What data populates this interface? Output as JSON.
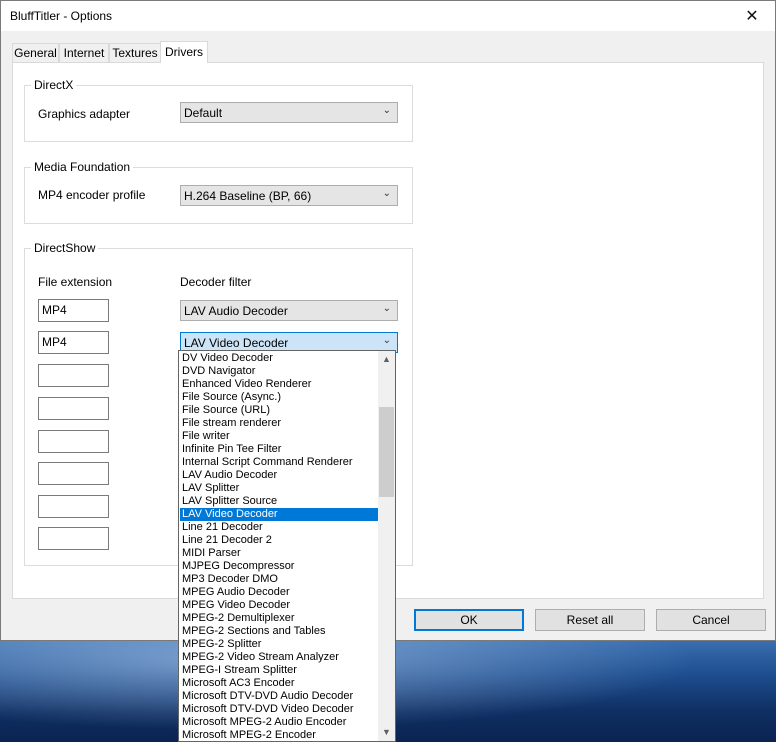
{
  "window": {
    "title": "BluffTitler - Options",
    "close_glyph": "✕"
  },
  "tabs": [
    {
      "label": "General"
    },
    {
      "label": "Internet"
    },
    {
      "label": "Textures"
    },
    {
      "label": "Drivers",
      "active": true
    }
  ],
  "directx": {
    "legend": "DirectX",
    "graphics_adapter_label": "Graphics adapter",
    "graphics_adapter_value": "Default"
  },
  "media_foundation": {
    "legend": "Media Foundation",
    "mp4_profile_label": "MP4 encoder profile",
    "mp4_profile_value": "H.264 Baseline (BP, 66)"
  },
  "directshow": {
    "legend": "DirectShow",
    "col_extension": "File extension",
    "col_decoder": "Decoder filter",
    "rows": [
      {
        "extension": "MP4",
        "decoder": "LAV Audio Decoder"
      },
      {
        "extension": "MP4",
        "decoder": "LAV Video Decoder"
      },
      {
        "extension": ""
      },
      {
        "extension": ""
      },
      {
        "extension": ""
      },
      {
        "extension": ""
      },
      {
        "extension": ""
      },
      {
        "extension": ""
      }
    ]
  },
  "decoder_dropdown": {
    "selected": "LAV Video Decoder",
    "items": [
      "DV Video Decoder",
      "DVD Navigator",
      "Enhanced Video Renderer",
      "File Source (Async.)",
      "File Source (URL)",
      "File stream renderer",
      "File writer",
      "Infinite Pin Tee Filter",
      "Internal Script Command Renderer",
      "LAV Audio Decoder",
      "LAV Splitter",
      "LAV Splitter Source",
      "LAV Video Decoder",
      "Line 21 Decoder",
      "Line 21 Decoder 2",
      "MIDI Parser",
      "MJPEG Decompressor",
      "MP3 Decoder DMO",
      "MPEG Audio Decoder",
      "MPEG Video Decoder",
      "MPEG-2 Demultiplexer",
      "MPEG-2 Sections and Tables",
      "MPEG-2 Splitter",
      "MPEG-2 Video Stream Analyzer",
      "MPEG-I Stream Splitter",
      "Microsoft AC3 Encoder",
      "Microsoft DTV-DVD Audio Decoder",
      "Microsoft DTV-DVD Video Decoder",
      "Microsoft MPEG-2 Audio Encoder",
      "Microsoft MPEG-2 Encoder"
    ]
  },
  "buttons": {
    "ok": "OK",
    "reset_all": "Reset all",
    "cancel": "Cancel"
  },
  "icons": {
    "combo_arrow": "chevron-down-icon",
    "scroll_up": "arrow-up-icon",
    "scroll_down": "arrow-down-icon"
  }
}
